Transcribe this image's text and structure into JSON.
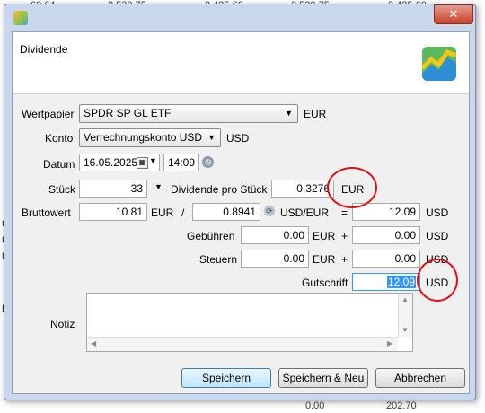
{
  "background": {
    "top_row": [
      "60.64",
      "2,530.75",
      "2,425.60",
      "2,530.75",
      "2,425.60"
    ],
    "faded_row": [
      "",
      "",
      "",
      "",
      ""
    ],
    "left_letters": [
      "U",
      "U",
      "U",
      "B"
    ],
    "bottom_row": [
      "0.00",
      "202.70"
    ]
  },
  "dialog": {
    "window_close": "✕",
    "header_title": "Dividende",
    "fields": {
      "wertpapier_label": "Wertpapier",
      "wertpapier_value": "SPDR SP GL ETF",
      "wertpapier_currency": "EUR",
      "konto_label": "Konto",
      "konto_value": "Verrechnungskonto USD",
      "konto_currency": "USD",
      "datum_label": "Datum",
      "datum_value": "16.05.2025",
      "time_value": "14:09",
      "stueck_label": "Stück",
      "stueck_value": "33",
      "dividende_label": "Dividende pro Stück",
      "dividende_value": "0.3276",
      "dividende_currency": "EUR",
      "bruttowert_label": "Bruttowert",
      "bruttowert_value": "10.81",
      "bruttowert_currency": "EUR",
      "slash": "/",
      "exchange_rate": "0.8941",
      "rate_unit": "USD/EUR",
      "equals": "=",
      "bruttowert_converted": "12.09",
      "bruttowert_converted_currency": "USD",
      "gebuehren_label": "Gebühren",
      "gebuehren_value": "0.00",
      "gebuehren_currency": "EUR",
      "plus1": "+",
      "gebuehren_converted": "0.00",
      "gebuehren_converted_currency": "USD",
      "steuern_label": "Steuern",
      "steuern_value": "0.00",
      "steuern_currency": "EUR",
      "plus2": "+",
      "steuern_converted": "0.00",
      "steuern_converted_currency": "USD",
      "gutschrift_label": "Gutschrift",
      "gutschrift_value": "12.09",
      "gutschrift_currency": "USD",
      "notiz_label": "Notiz"
    },
    "buttons": {
      "save": "Speichern",
      "save_new": "Speichern & Neu",
      "cancel": "Abbrechen"
    }
  },
  "colors": {
    "selection": "#3399ff",
    "annotation_red": "#e01010"
  }
}
